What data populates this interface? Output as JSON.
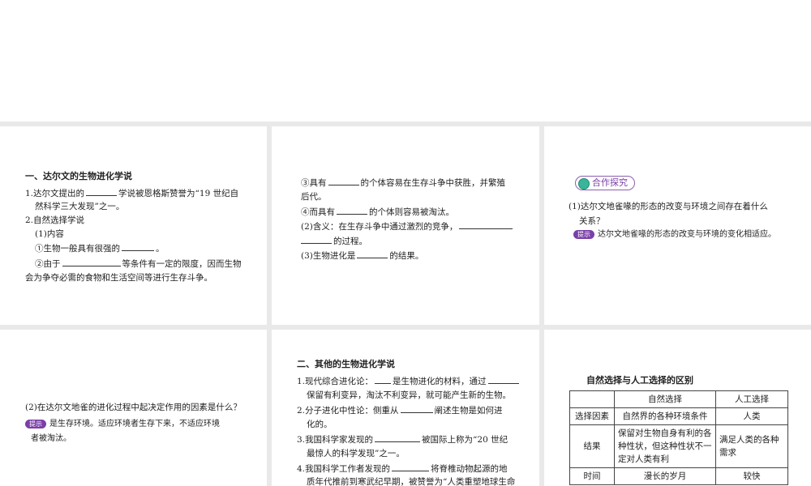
{
  "panel1": {
    "heading": "一、达尔文的生物进化学说",
    "l1a": "1.达尔文提出的",
    "l1b": "学说被恩格斯赞誉为“19 世纪自",
    "l2": "然科学三大发现”之一。",
    "l3": "2.自然选择学说",
    "l4": "(1)内容",
    "l5a": "①生物一般具有很强的",
    "l5b": "。",
    "l6a": "②由于",
    "l6b": "等条件有一定的限度，因而生物",
    "l7": "会为争夺必需的食物和生活空间等进行生存斗争。"
  },
  "panel2": {
    "l1a": "③具有",
    "l1b": "的个体容易在生存斗争中获胜，并繁殖",
    "l2": "后代。",
    "l3a": "④而具有",
    "l3b": "的个体则容易被淘汰。",
    "l4a": "(2)含义：在生存斗争中通过激烈的竞争，",
    "l5b": "的过程。",
    "l6a": "(3)生物进化是",
    "l6b": "的结果。"
  },
  "panel3": {
    "badge": "合作探究",
    "q1": "(1)达尔文地雀喙的形态的改变与环境之间存在着什么",
    "q2": "关系？",
    "hint_label": "提示",
    "hint_text": "达尔文地雀喙的形态的改变与环境的变化相适应。"
  },
  "panel4": {
    "q": "(2)在达尔文地雀的进化过程中起决定作用的因素是什么？",
    "hint_label": "提示",
    "a1": "是生存环境。适应环境者生存下来，不适应环境",
    "a2": "者被淘汰。"
  },
  "panel5": {
    "heading": "二、其他的生物进化学说",
    "l1a": "1.现代综合进化论：",
    "l1b": "是生物进化的材料，通过",
    "l2": "保留有利变异，淘汰不利变异，就可能产生新的生物。",
    "l3a": "2.分子进化中性论：侧重从",
    "l3b": "阐述生物是如何进",
    "l4": "化的。",
    "l5a": "3.我国科学家发现的",
    "l5b": "被国际上称为“20 世纪",
    "l6": "最惊人的科学发现”之一。",
    "l7a": "4.我国科学工作者发现的",
    "l7b": "将脊椎动物起源的地",
    "l8": "质年代推前到寒武纪早期，被赞誉为“人类重塑地球生命"
  },
  "panel6": {
    "title": "自然选择与人工选择的区别",
    "header": [
      "",
      "自然选择",
      "人工选择"
    ],
    "rows": [
      [
        "选择因素",
        "自然界的各种环境条件",
        "人类"
      ],
      [
        "结果",
        "保留对生物自身有利的各种性状，但这种性状不一定对人类有利",
        "满足人类的各种需求"
      ],
      [
        "时间",
        "漫长的岁月",
        "较快"
      ]
    ]
  }
}
